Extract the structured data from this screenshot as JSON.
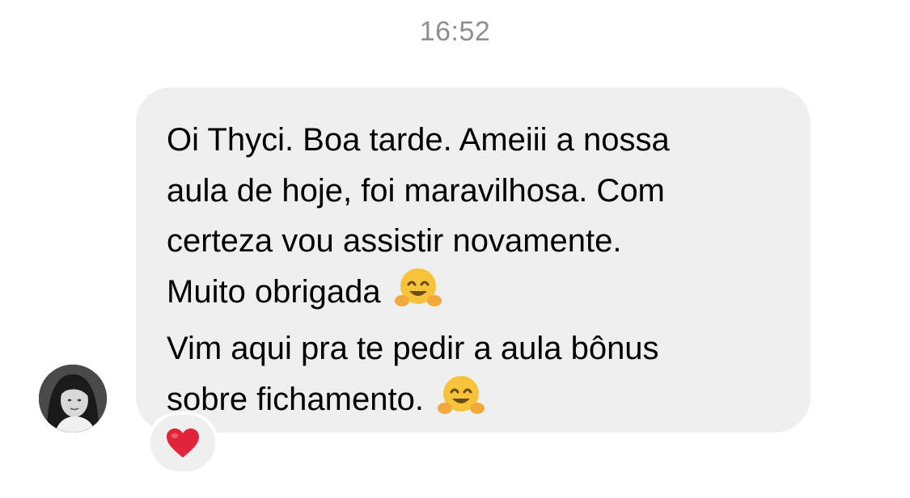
{
  "thread": {
    "timestamp": "16:52"
  },
  "message": {
    "lines": [
      "Oi Thyci. Boa tarde. Ameiii a nossa",
      "aula de hoje, foi maravilhosa. Com",
      "certeza vou assistir novamente.",
      "Muito obrigada",
      "Vim aqui pra te pedir a aula bônus",
      "sobre fichamento."
    ],
    "emoji": "hugging-face-icon",
    "reaction": "red-heart-icon"
  },
  "colors": {
    "bubble": "#efefef",
    "timestamp": "#8e8e93",
    "text": "#000000",
    "heart": "#e0243a",
    "emoji": "#f7c33b"
  }
}
